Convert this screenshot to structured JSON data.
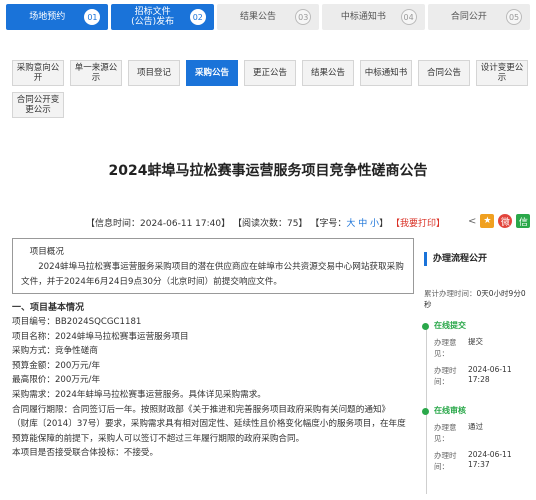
{
  "steps": [
    {
      "label": "场地预约",
      "num": "01",
      "active": true
    },
    {
      "label": "招标文件\n(公告)发布",
      "num": "02",
      "active": true
    },
    {
      "label": "结果公告",
      "num": "03",
      "active": false
    },
    {
      "label": "中标通知书",
      "num": "04",
      "active": false
    },
    {
      "label": "合同公开",
      "num": "05",
      "active": false
    }
  ],
  "tabs": [
    {
      "label": "采购意向公开",
      "active": false
    },
    {
      "label": "单一来源公示",
      "active": false
    },
    {
      "label": "项目登记",
      "active": false
    },
    {
      "label": "采购公告",
      "active": true
    },
    {
      "label": "更正公告",
      "active": false
    },
    {
      "label": "结果公告",
      "active": false
    },
    {
      "label": "中标通知书",
      "active": false
    },
    {
      "label": "合同公告",
      "active": false
    },
    {
      "label": "设计变更公示",
      "active": false
    },
    {
      "label": "合同公开变更公示",
      "active": false
    }
  ],
  "title": "2024蚌埠马拉松赛事运营服务项目竞争性磋商公告",
  "info": {
    "time_label": "【信息时间：2024-06-11 17:40】",
    "views_label": "【阅读次数：75】",
    "font_label": "【字号：",
    "font_sizes": "大 中 小",
    "font_end": "】",
    "print": "【我要打印】"
  },
  "notice": {
    "head": "项目概况",
    "body": "2024蚌埠马拉松赛事运营服务采购项目的潜在供应商应在蚌埠市公共资源交易中心网站获取采购文件，并于2024年6月24日9点30分（北京时间）前提交响应文件。"
  },
  "section1": "一、项目基本情况",
  "lines": [
    "项目编号：BB2024SQCGC1181",
    "项目名称：2024蚌埠马拉松赛事运营服务项目",
    "采购方式：竞争性磋商",
    "预算金额：200万元/年",
    "最高限价：200万元/年",
    "采购需求：2024年蚌埠马拉松赛事运营服务。具体详见采购需求。",
    "合同履行期限：合同签订后一年。按照财政部《关于推进和完善服务项目政府采购有关问题的通知》",
    "（财库〔2014〕37号）要求，采购需求具有相对固定性、延续性且价格变化幅度小的服务项目，在年度",
    "预算能保障的前提下，采购人可以签订不超过三年履行期限的政府采购合同。",
    "本项目是否接受联合体投标：不接受。"
  ],
  "side": {
    "head": "办理流程公开",
    "elapsed_label": "累计办理时间：",
    "elapsed_value": "0天0小时9分0秒",
    "nodes": [
      {
        "title": "在线提交",
        "k1": "办理意见：",
        "v1": "提交",
        "k2": "办理时间：",
        "v2": "2024-06-11\n17:28"
      },
      {
        "title": "在线审核",
        "k1": "办理意见：",
        "v1": "通过",
        "k2": "办理时间：",
        "v2": "2024-06-11\n17:37"
      }
    ]
  },
  "colors": {
    "accent": "#1a73d9",
    "green": "#2aa84a"
  }
}
